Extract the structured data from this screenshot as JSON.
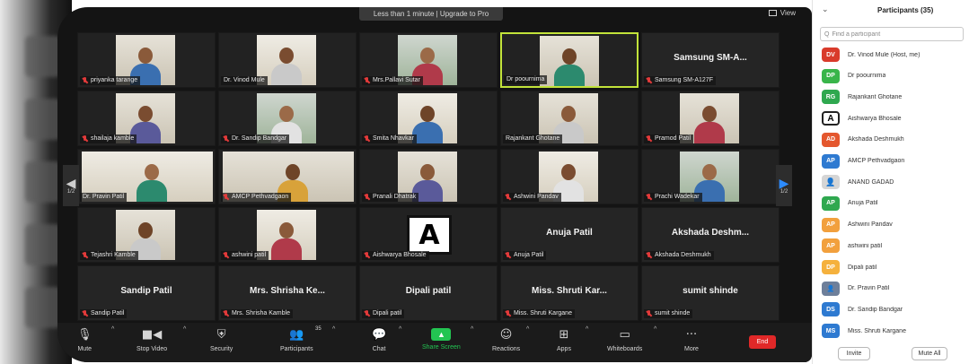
{
  "window": {
    "upgrade_banner": "Less than 1 minute | Upgrade to Pro",
    "view_label": "View"
  },
  "gallery": {
    "page_left": "1/2",
    "page_right": "1/2",
    "tiles": [
      {
        "label": "priyanka tarange",
        "kind": "video"
      },
      {
        "label": "Dr. Vinod Mule",
        "kind": "video",
        "unmuted": true
      },
      {
        "label": "Mrs.Pallavi Sutar",
        "kind": "video"
      },
      {
        "label": "Dr poournima",
        "kind": "video",
        "unmuted": true,
        "active": true
      },
      {
        "label": "Samsung SM-A127F",
        "kind": "name",
        "big": "Samsung SM-A..."
      },
      {
        "label": "shailaja kamble",
        "kind": "video"
      },
      {
        "label": "Dr. Sandip Bandgar",
        "kind": "video"
      },
      {
        "label": "Smita Nhavkar",
        "kind": "video"
      },
      {
        "label": "Rajankant Ghotane",
        "kind": "video",
        "unmuted": true
      },
      {
        "label": "Pramod Patil",
        "kind": "video"
      },
      {
        "label": "Dr. Pravin Patil",
        "kind": "video-wide",
        "unmuted": true
      },
      {
        "label": "AMCP Pethvadgaon",
        "kind": "video-wide"
      },
      {
        "label": "Pranali Dhatrak",
        "kind": "video"
      },
      {
        "label": "Ashwini Pandav",
        "kind": "video"
      },
      {
        "label": "Prachi Wadekar",
        "kind": "video"
      },
      {
        "label": "Tejashri Kamble",
        "kind": "video"
      },
      {
        "label": "ashwini patil",
        "kind": "video"
      },
      {
        "label": "Aishwarya Bhosale",
        "kind": "avatar",
        "avatar_letter": "A"
      },
      {
        "label": "Anuja Patil",
        "kind": "name",
        "big": "Anuja Patil"
      },
      {
        "label": "Akshada Deshmukh",
        "kind": "name",
        "big": "Akshada Deshm..."
      },
      {
        "label": "Sandip Patil",
        "kind": "name",
        "big": "Sandip Patil"
      },
      {
        "label": "Mrs. Shrisha Kamble",
        "kind": "name",
        "big": "Mrs. Shrisha Ke..."
      },
      {
        "label": "Dipali patil",
        "kind": "name",
        "big": "Dipali patil"
      },
      {
        "label": "Miss. Shruti Kargane",
        "kind": "name",
        "big": "Miss. Shruti Kar..."
      },
      {
        "label": "sumit shinde",
        "kind": "name",
        "big": "sumit shinde"
      }
    ]
  },
  "toolbar": {
    "mute": "Mute",
    "stop_video": "Stop Video",
    "security": "Security",
    "participants": "Participants",
    "participants_count": "35",
    "chat": "Chat",
    "share_screen": "Share Screen",
    "reactions": "Reactions",
    "apps": "Apps",
    "whiteboards": "Whiteboards",
    "more": "More",
    "end": "End"
  },
  "panel": {
    "title": "Participants (35)",
    "search_placeholder": "Find a participant",
    "participants": [
      {
        "initials": "DV",
        "color": "#d93b2b",
        "name": "Dr. Vinod Mule (Host, me)"
      },
      {
        "initials": "DP",
        "color": "#39b54a",
        "name": "Dr poournima"
      },
      {
        "initials": "RG",
        "color": "#2fa84f",
        "name": "Rajankant Ghotane"
      },
      {
        "initials": "A",
        "color": "#ffffff",
        "name": "Aishwarya Bhosale",
        "style": "img-a"
      },
      {
        "initials": "AD",
        "color": "#e4572e",
        "name": "Akshada Deshmukh"
      },
      {
        "initials": "AP",
        "color": "#2e7ad1",
        "name": "AMCP Pethvadgaon"
      },
      {
        "initials": "",
        "color": "#d5d5d5",
        "name": "ANAND GADAD",
        "style": "img-anon"
      },
      {
        "initials": "AP",
        "color": "#2fa84f",
        "name": "Anuja Patil"
      },
      {
        "initials": "AP",
        "color": "#f2a03d",
        "name": "Ashwini Pandav"
      },
      {
        "initials": "AP",
        "color": "#f2a03d",
        "name": "ashwini patil"
      },
      {
        "initials": "DP",
        "color": "#f5b13d",
        "name": "Dipali patil"
      },
      {
        "initials": "",
        "color": "#6e7f9a",
        "name": "Dr. Pravin Patil",
        "style": "img-person"
      },
      {
        "initials": "DS",
        "color": "#2e7ad1",
        "name": "Dr. Sandip Bandgar"
      },
      {
        "initials": "MS",
        "color": "#2e7ad1",
        "name": "Miss. Shruti Kargane"
      }
    ],
    "invite": "Invite",
    "mute_all": "Mute All"
  }
}
